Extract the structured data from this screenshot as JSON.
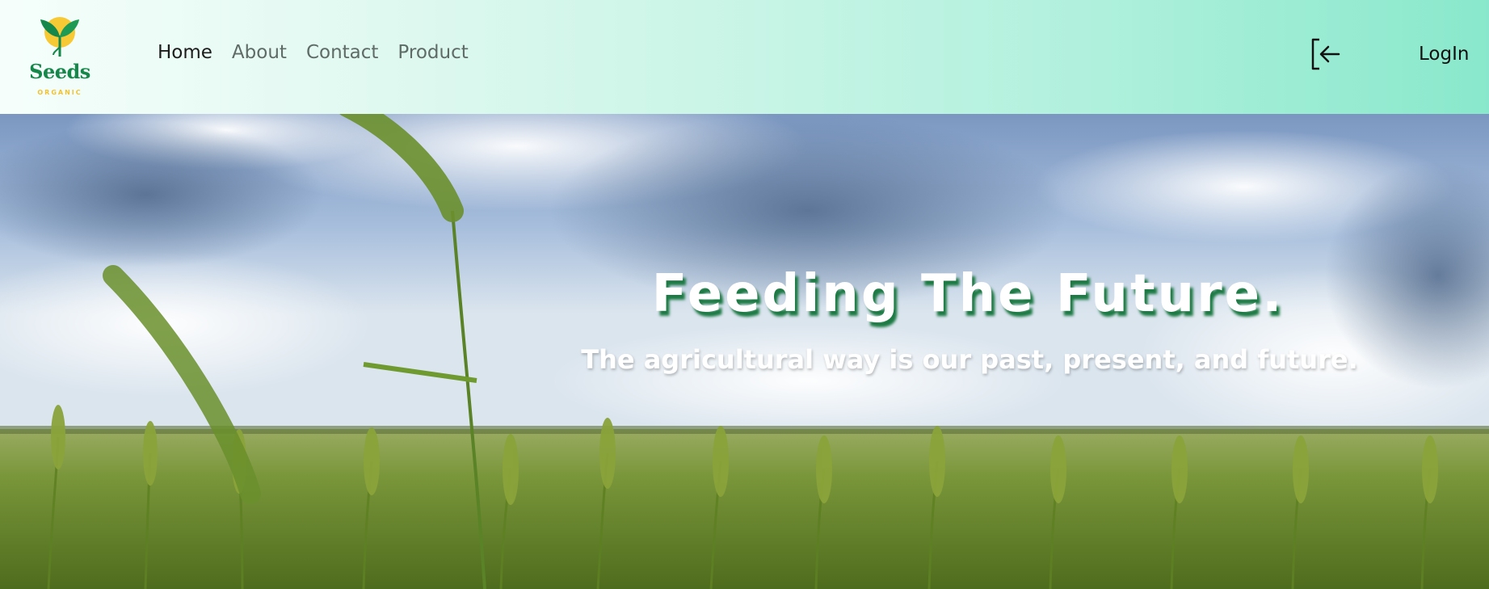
{
  "brand": {
    "name": "Seeds",
    "tagline": "ORGANIC"
  },
  "nav": {
    "links": [
      "Home",
      "About",
      "Contact",
      "Product"
    ],
    "active": "Home",
    "login_label": "LogIn"
  },
  "hero": {
    "title": "Feeding The Future.",
    "subtitle": "The agricultural way is our past, present, and future."
  },
  "colors": {
    "brand_green": "#16874a",
    "brand_yellow": "#f2c230",
    "navbar_gradient_end": "#89e8cb",
    "title_shadow": "#1d7a44"
  },
  "icons": {
    "logo": "sprout-sun-logo",
    "login": "login-arrow-icon"
  }
}
